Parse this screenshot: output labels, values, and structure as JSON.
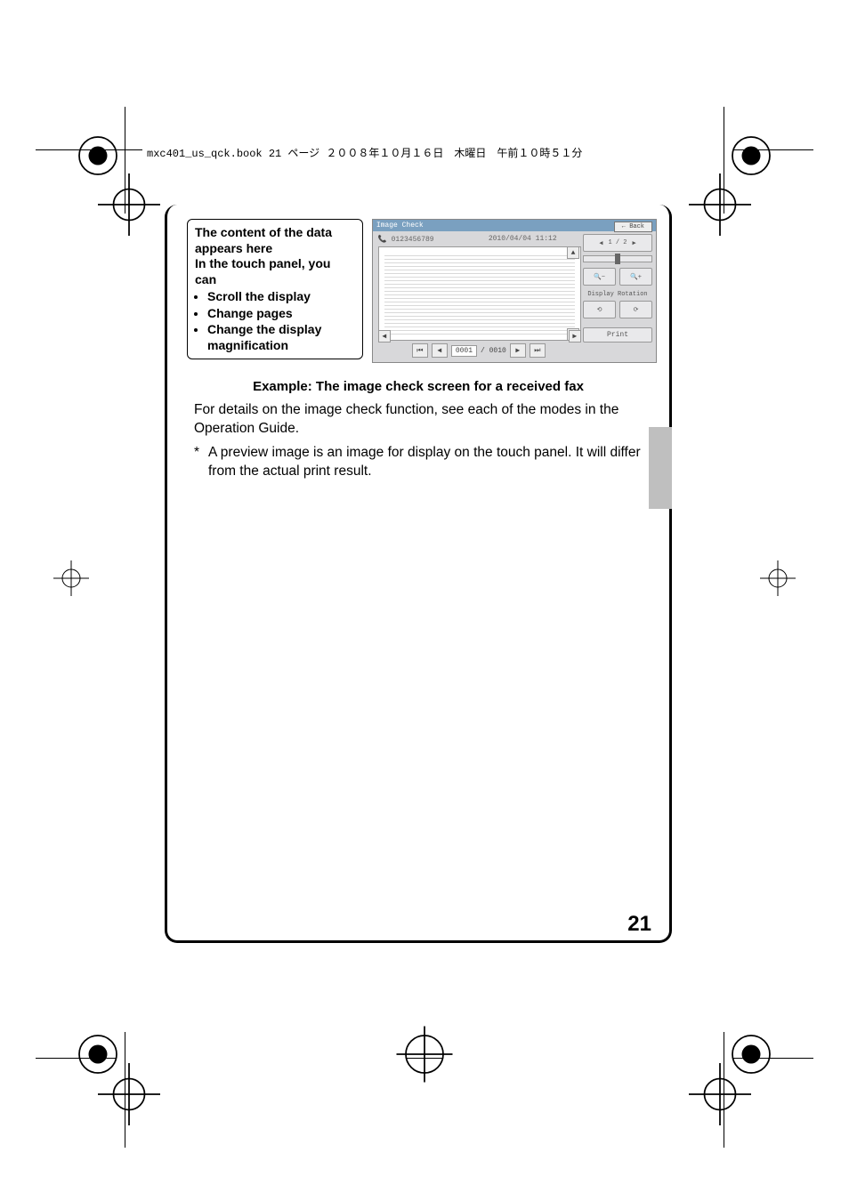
{
  "header_line": "mxc401_us_qck.book  21 ページ  ２００８年１０月１６日　木曜日　午前１０時５１分",
  "callout": {
    "intro1": "The content of the data appears here",
    "intro2": "In the touch panel, you can",
    "items": [
      "Scroll the display",
      "Change pages",
      "Change the display magnification"
    ]
  },
  "screenshot": {
    "title": "Image Check",
    "back": "Back",
    "phone": "0123456789",
    "datetime": "2010/04/04  11:12",
    "page_current": "0001",
    "page_total": "/ 0010",
    "copies": "1 / 2",
    "rotation_label": "Display Rotation",
    "print": "Print"
  },
  "caption": "Example: The image check screen for a received fax",
  "para1": "For details on the image check function, see each of the modes in the Operation Guide.",
  "note_marker": "*",
  "para2": "A preview image is an image for display on the touch panel. It will differ from the actual print result.",
  "page_number": "21"
}
